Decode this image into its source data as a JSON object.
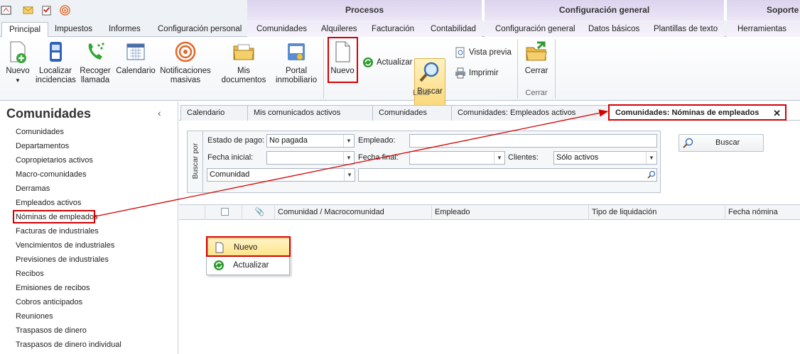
{
  "ribbon_groups": {
    "procesos": "Procesos",
    "configuracion": "Configuración general",
    "soporte": "Soporte"
  },
  "tabs": [
    "Principal",
    "Impuestos",
    "Informes",
    "Configuración personal",
    "Comunidades",
    "Alquileres",
    "Facturación",
    "Contabilidad",
    "Configuración general",
    "Datos básicos",
    "Plantillas de texto",
    "Herramientas"
  ],
  "ribbon": {
    "nuevo": "Nuevo",
    "localizar": "Localizar incidencias",
    "recoger": "Recoger llamada",
    "calendario": "Calendario",
    "notificaciones": "Notificaciones masivas",
    "documentos": "Mis documentos",
    "portal": "Portal inmobiliario",
    "nuevo_doc": "Nuevo",
    "actualizar": "Actualizar",
    "buscar": "Buscar",
    "vista_previa": "Vista previa",
    "imprimir": "Imprimir",
    "lista_group": "Lista",
    "cerrar": "Cerrar",
    "cerrar_group": "Cerrar"
  },
  "sidebar": {
    "title": "Comunidades",
    "items": [
      "Comunidades",
      "Departamentos",
      "Copropietarios activos",
      "Macro-comunidades",
      "Derramas",
      "Empleados activos",
      "Nóminas de empleados",
      "Facturas de industriales",
      "Vencimientos de industriales",
      "Previsiones de industriales",
      "Recibos",
      "Emisiones de recibos",
      "Cobros anticipados",
      "Reuniones",
      "Traspasos de dinero",
      "Traspasos de dinero individual"
    ]
  },
  "doc_tabs": [
    "Calendario",
    "Mis comunicados activos",
    "Comunidades",
    "Comunidades: Empleados activos",
    "Comunidades: Nóminas de empleados"
  ],
  "filter": {
    "side_label": "Buscar por",
    "estado_label": "Estado de pago:",
    "estado_value": "No pagada",
    "empleado_label": "Empleado:",
    "fecha_inicial_label": "Fecha inicial:",
    "fecha_final_label": "Fecha final:",
    "clientes_label": "Clientes:",
    "clientes_value": "Sólo activos",
    "comunidad_value": "Comunidad",
    "buscar_button": "Buscar"
  },
  "grid_columns": [
    "Comunidad / Macrocomunidad",
    "Empleado",
    "Tipo de liquidación",
    "Fecha nómina"
  ],
  "context_menu": [
    "Nuevo",
    "Actualizar"
  ],
  "colors": {
    "highlight_red": "#d40000",
    "ctx_purple": "#dcd3ee"
  }
}
